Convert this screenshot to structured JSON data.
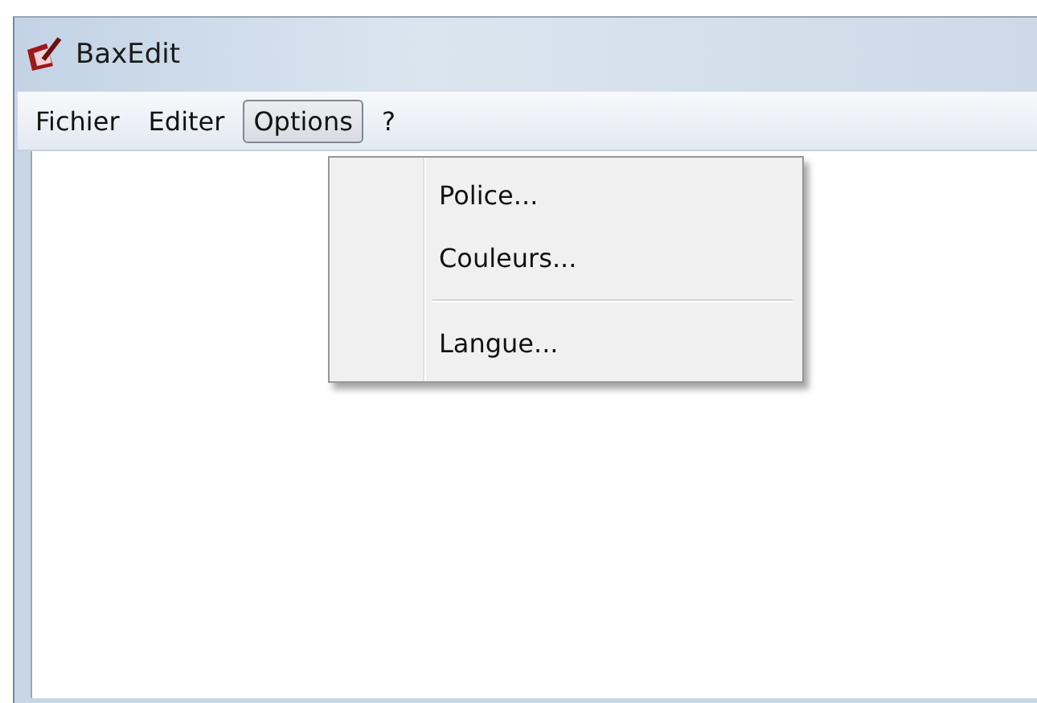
{
  "window": {
    "title": "BaxEdit"
  },
  "menu_bar": [
    {
      "label": "Fichier",
      "selected": false
    },
    {
      "label": "Editer",
      "selected": false
    },
    {
      "label": "Options",
      "selected": true
    },
    {
      "label": "?",
      "selected": false
    }
  ],
  "open_menu": {
    "items": [
      {
        "kind": "item",
        "label": "Police..."
      },
      {
        "kind": "item",
        "label": "Couleurs..."
      },
      {
        "kind": "separator"
      },
      {
        "kind": "item",
        "label": "Langue..."
      }
    ]
  }
}
